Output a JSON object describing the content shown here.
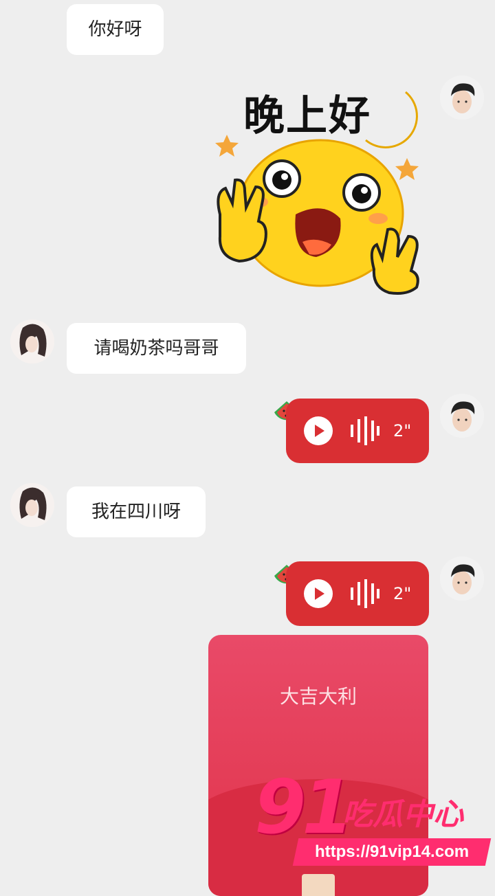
{
  "messages": {
    "greeting": "你好呀",
    "sticker_text": "晚上好",
    "milk_tea": "请喝奶茶吗哥哥",
    "location": "我在四川呀",
    "voice_1_duration": "2\"",
    "voice_2_duration": "2\""
  },
  "red_packet": {
    "greeting": "大吉大利"
  },
  "watermark": {
    "number": "91",
    "brand": "吃瓜中心",
    "url": "https://91vip14.com"
  },
  "colors": {
    "voice_bubble": "#d92f33",
    "red_packet": "#e94a68",
    "watermark": "#ff2d6f",
    "chat_background": "#eeeeee"
  },
  "icons": [
    "play-icon",
    "sound-wave-icon",
    "watermelon-icon",
    "avatar-icon"
  ]
}
